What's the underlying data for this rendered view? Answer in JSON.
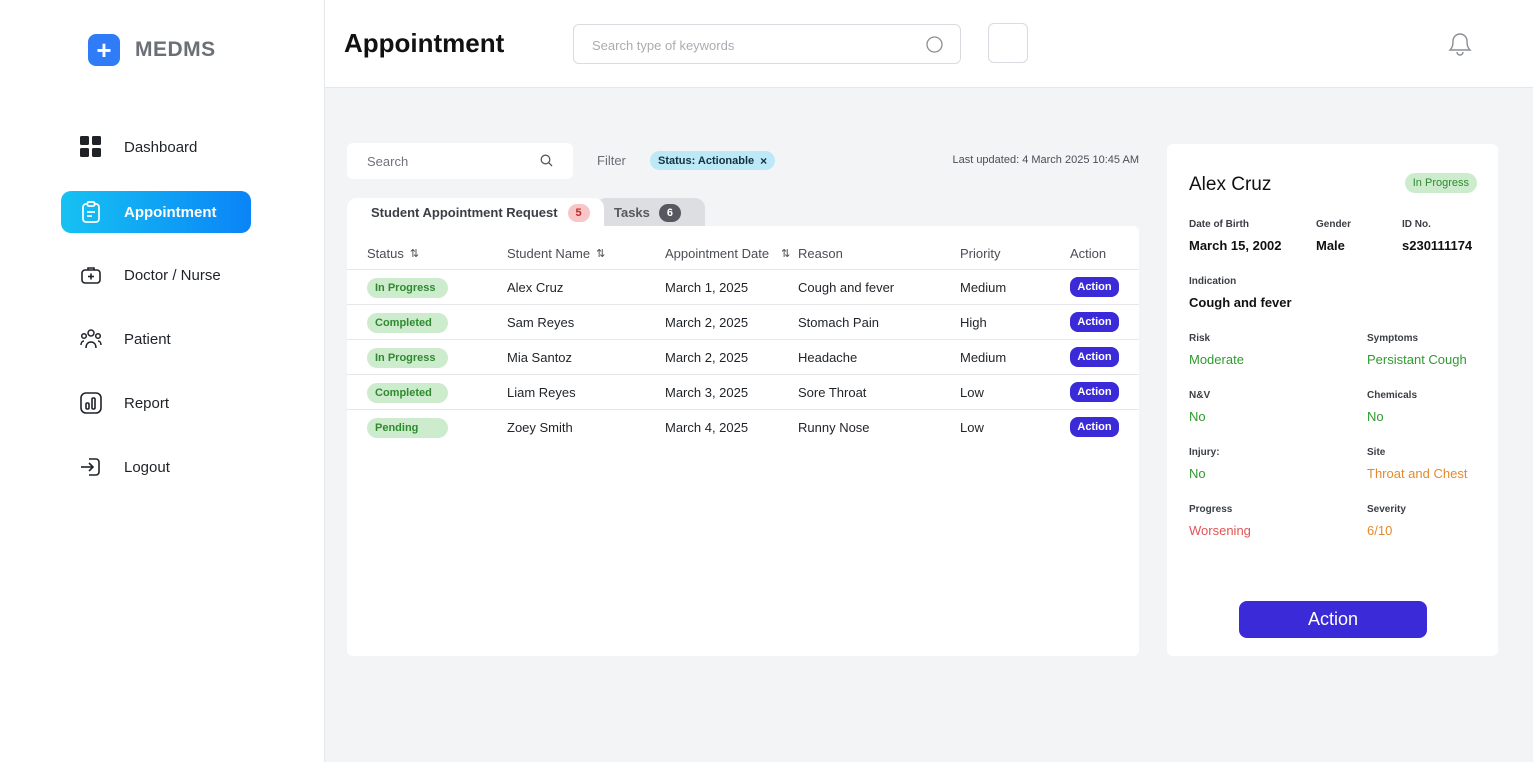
{
  "brand": {
    "name": "MEDMS",
    "logo_glyph": "+",
    "logo_color": "#2f7cf6"
  },
  "sidebar": {
    "items": [
      {
        "label": "Dashboard",
        "icon": "grid-icon",
        "active": false
      },
      {
        "label": "Appointment",
        "icon": "clipboard-icon",
        "active": true
      },
      {
        "label": "Doctor / Nurse",
        "icon": "medical-bag-icon",
        "active": false
      },
      {
        "label": "Patient",
        "icon": "people-icon",
        "active": false
      },
      {
        "label": "Report",
        "icon": "bar-chart-icon",
        "active": false
      },
      {
        "label": "Logout",
        "icon": "logout-icon",
        "active": false
      }
    ]
  },
  "header": {
    "title": "Appointment",
    "search_placeholder": "Search type of keywords"
  },
  "toolbar": {
    "search_placeholder": "Search",
    "filter_label": "Filter",
    "chip_label": "Status: Actionable",
    "chip_close": "×",
    "last_updated": "Last updated: 4 March 2025 10:45 AM"
  },
  "tabs": [
    {
      "label": "Student Appointment Request",
      "count": "5"
    },
    {
      "label": "Tasks",
      "count": "6"
    }
  ],
  "table": {
    "columns": [
      "Status",
      "Student Name",
      "Appointment Date",
      "Reason",
      "Priority",
      "Action"
    ],
    "sort_glyph": "⇅",
    "rows": [
      {
        "status": "In Progress",
        "name": "Alex Cruz",
        "date": "March 1, 2025",
        "reason": "Cough and fever",
        "priority": "Medium",
        "action": "Action"
      },
      {
        "status": "Completed",
        "name": "Sam Reyes",
        "date": "March 2, 2025",
        "reason": "Stomach Pain",
        "priority": "High",
        "action": "Action"
      },
      {
        "status": "In Progress",
        "name": "Mia Santoz",
        "date": "March 2, 2025",
        "reason": "Headache",
        "priority": "Medium",
        "action": "Action"
      },
      {
        "status": "Completed",
        "name": "Liam Reyes",
        "date": "March 3, 2025",
        "reason": "Sore Throat",
        "priority": "Low",
        "action": "Action"
      },
      {
        "status": "Pending",
        "name": "Zoey Smith",
        "date": "March 4, 2025",
        "reason": "Runny Nose",
        "priority": "Low",
        "action": "Action"
      }
    ]
  },
  "detail": {
    "name": "Alex Cruz",
    "status": "In Progress",
    "dob_label": "Date of Birth",
    "dob": "March 15, 2002",
    "gender_label": "Gender",
    "gender": "Male",
    "id_label": "ID No.",
    "id": "s230111174",
    "indication_label": "Indication",
    "indication": "Cough and fever",
    "risk_label": "Risk",
    "risk": "Moderate",
    "symptoms_label": "Symptoms",
    "symptoms": "Persistant Cough",
    "nv_label": "N&V",
    "nv": "No",
    "chemicals_label": "Chemicals",
    "chemicals": "No",
    "injury_label": "Injury:",
    "injury": "No",
    "site_label": "Site",
    "site": "Throat and Chest",
    "progress_label": "Progress",
    "progress": "Worsening",
    "severity_label": "Severity",
    "severity": "6/10",
    "action_label": "Action"
  },
  "colors": {
    "accent": "#3a2ad8",
    "active_nav_start": "#16c2f2",
    "active_nav_end": "#0a84f7",
    "status_green_bg": "#cdeccd",
    "status_green_text": "#2f8a2f",
    "value_green": "#2f9a2f",
    "value_orange": "#e58a2c",
    "value_red": "#e25555"
  }
}
